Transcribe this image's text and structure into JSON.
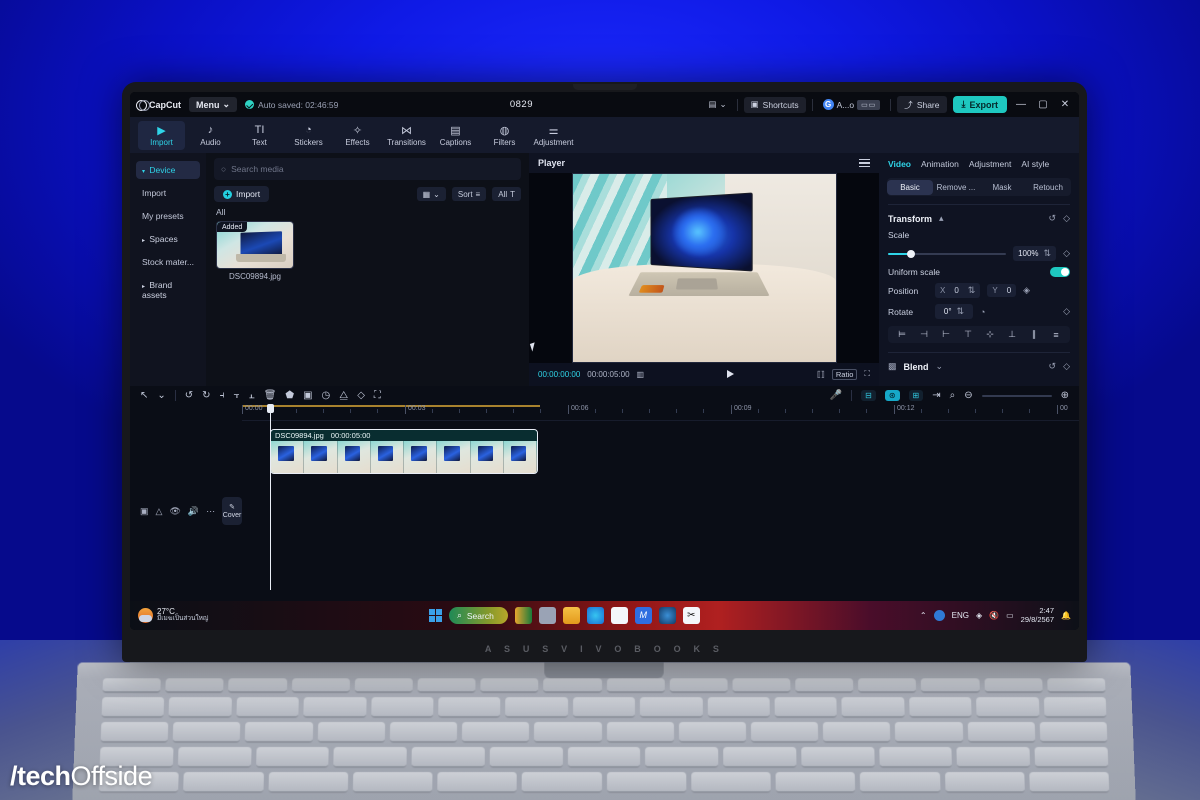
{
  "scene": {
    "watermark_slash": "/tech",
    "watermark_rest": "Offside",
    "laptop_brand": "A S U S   V I V O B O O K   S"
  },
  "titlebar": {
    "app_name": "CapCut",
    "menu_label": "Menu",
    "menu_caret": "⌄",
    "autosave_text": "Auto saved: 02:46:59",
    "project_title": "0829",
    "layout_icon": "layout-icon",
    "layout_caret": "⌄",
    "shortcuts_label": "Shortcuts",
    "account_badge": "G",
    "account_label": "A...o",
    "account_kbd": "▭▭",
    "share_label": "Share",
    "export_label": "Export",
    "minimize": "—",
    "maximize": "▢",
    "close": "✕"
  },
  "navtabs": [
    {
      "label": "Import",
      "icon": "▶",
      "active": true
    },
    {
      "label": "Audio",
      "icon": "♪",
      "active": false
    },
    {
      "label": "Text",
      "icon": "TI",
      "active": false
    },
    {
      "label": "Stickers",
      "icon": "◔",
      "active": false
    },
    {
      "label": "Effects",
      "icon": "✧",
      "active": false
    },
    {
      "label": "Transitions",
      "icon": "⋈",
      "active": false
    },
    {
      "label": "Captions",
      "icon": "▤",
      "active": false
    },
    {
      "label": "Filters",
      "icon": "◍",
      "active": false
    },
    {
      "label": "Adjustment",
      "icon": "⚌",
      "active": false
    }
  ],
  "sidebar": {
    "items": [
      {
        "label": "Device",
        "caret": "▾",
        "selected": true
      },
      {
        "label": "Import",
        "caret": "",
        "selected": false
      },
      {
        "label": "My presets",
        "caret": "",
        "selected": false
      },
      {
        "label": "Spaces",
        "caret": "▸",
        "selected": false
      },
      {
        "label": "Stock mater...",
        "caret": "",
        "selected": false
      },
      {
        "label": "Brand assets",
        "caret": "▸",
        "selected": false
      }
    ]
  },
  "media": {
    "search_placeholder": "Search media",
    "search_icon": "○",
    "import_label": "Import",
    "view_icon": "▦",
    "view_caret": "⌄",
    "sort_label": "Sort",
    "sort_icon": "≡",
    "all_label": "All",
    "filter_icon": "T",
    "group_label": "All",
    "items": [
      {
        "name": "DSC09894.jpg",
        "badge": "Added"
      }
    ]
  },
  "player": {
    "title": "Player",
    "current_time": "00:00:00:00",
    "total_time": "00:00:05:00",
    "grid_icon": "▥",
    "play_icon": "play-icon",
    "fit_icon": "⟦⟧",
    "ratio_label": "Ratio",
    "fullscreen_icon": "⛶"
  },
  "props": {
    "tabs": [
      {
        "label": "Video",
        "active": true
      },
      {
        "label": "Animation",
        "active": false
      },
      {
        "label": "Adjustment",
        "active": false
      },
      {
        "label": "AI style",
        "active": false
      }
    ],
    "subtabs": [
      {
        "label": "Basic",
        "active": true
      },
      {
        "label": "Remove ...",
        "active": false
      },
      {
        "label": "Mask",
        "active": false
      },
      {
        "label": "Retouch",
        "active": false
      }
    ],
    "transform_title": "Transform",
    "transform_caret": "▴",
    "reset_icon": "↺",
    "key_icon": "◇",
    "scale_label": "Scale",
    "scale_value": "100%",
    "uniform_scale_label": "Uniform scale",
    "uniform_scale_on": true,
    "position_label": "Position",
    "position_x_axis": "X",
    "position_x_value": "0",
    "position_y_axis": "Y",
    "position_y_value": "0",
    "rotate_label": "Rotate",
    "rotate_value": "0°",
    "align_icons": [
      "⊨",
      "⊣",
      "⊢",
      "⊤",
      "⊹",
      "⊥",
      "∥",
      "≡"
    ],
    "blend_label": "Blend",
    "blend_caret": "⌄"
  },
  "timeline": {
    "tools": [
      "↖",
      "⌄",
      "↺",
      "↻",
      "⫞",
      "⫟",
      "⫠",
      "🗑",
      "⬟",
      "▣",
      "◷",
      "⧋",
      "◇",
      "⛶"
    ],
    "right_tools": [
      "🎤",
      "⊟",
      "⊛",
      "⊞",
      "⇥",
      "⌕"
    ],
    "zoom_out": "⊖",
    "zoom_in": "⊕",
    "ruler_ticks": [
      "00:00",
      "00:03",
      "00:06",
      "00:09",
      "00:12",
      "00"
    ],
    "track_icons": [
      "▣",
      "△",
      "👁",
      "🔊",
      "⋯"
    ],
    "cover_label": "Cover",
    "cover_icon": "✎",
    "clip": {
      "name": "DSC09894.jpg",
      "duration": "00:00:05:00"
    }
  },
  "taskbar": {
    "weather_temp": "27°C",
    "weather_desc": "มีเมฆเป็นส่วนใหญ่",
    "search_placeholder": "Search",
    "search_icon": "search-icon",
    "start_icon": "windows-start-icon",
    "apps": [
      "app-thai-icon",
      "task-view-icon",
      "file-explorer-icon",
      "edge-icon",
      "store-icon",
      "app-m-icon",
      "steam-icon",
      "capcut-icon"
    ],
    "tray_chevron": "⌃",
    "language": "ENG",
    "wifi_icon": "◈",
    "volume_icon": "🔇",
    "battery_icon": "▭",
    "time": "2:47",
    "date": "29/8/2567",
    "notify_icon": "🔔"
  }
}
